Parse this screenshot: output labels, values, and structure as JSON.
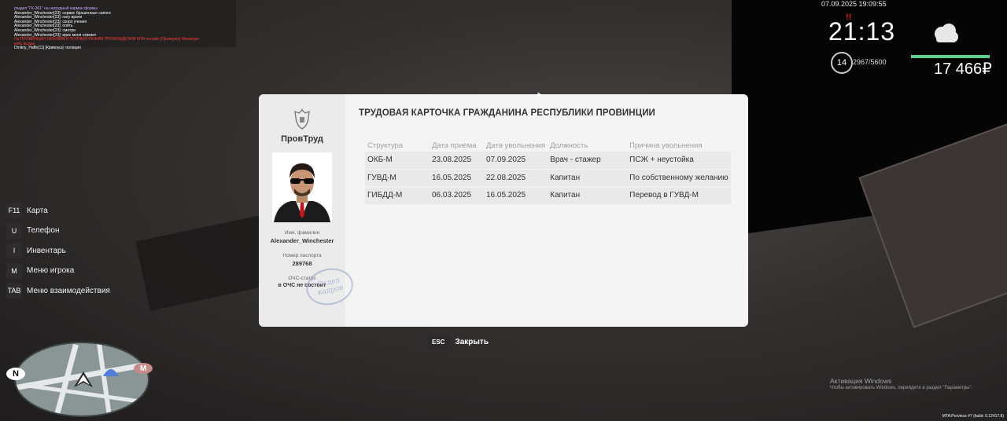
{
  "chat": [
    {
      "text": "раздел \"ГК-361\" на нагрудный карман формы",
      "color": "#c9a9ff"
    },
    {
      "text": "Alexander_Winchester[23]: сервис брошенные сапоги",
      "color": "#ffffff"
    },
    {
      "text": "Alexander_Winchester[23]: нагу врачи",
      "color": "#ffffff"
    },
    {
      "text": "Alexander_Winchester[23]: скоро учения",
      "color": "#ffffff"
    },
    {
      "text": "Alexander_Winchester[23]: опять",
      "color": "#ffffff"
    },
    {
      "text": "Alexander_Winchester[23]: смотри",
      "color": "#ffffff"
    },
    {
      "text": "Alexander_Winchester[23]: ирис меня отвезет",
      "color": "#ffffff"
    },
    {
      "text": "На ПРОВИНЦИИ ОБЪЯВЛЕН ПОЛНЫЙ РЕЖИМ ПРОХОЖДЕНИЯ МТА онлайн (Проверка) Минимум",
      "color": "#ff3b3b"
    },
    {
      "text": "кейс выдан",
      "color": "#ff3b3b"
    },
    {
      "text": "Dmitriy_Haffe[11] [Кривоуш]: полиция",
      "color": "#ffffff"
    }
  ],
  "hud": {
    "datetime": "07.09.2025 19:09:55",
    "mark": "!!",
    "clock": "21:13",
    "level": "14",
    "exp": "2967/5600",
    "bar_fill_percent": 100,
    "bar_color": "#5fd38e",
    "money": "17 466₽",
    "weather_icon": "cloud-icon"
  },
  "hotkeys": [
    {
      "key": "F11",
      "label": "Карта"
    },
    {
      "key": "U",
      "label": "Телефон"
    },
    {
      "key": "I",
      "label": "Инвентарь"
    },
    {
      "key": "M",
      "label": "Меню игрока"
    },
    {
      "key": "TAB",
      "label": "Меню взаимодействия"
    }
  ],
  "minimap": {
    "north": "N",
    "metro": "M"
  },
  "card": {
    "org": "ПровТруд",
    "title": "ТРУДОВАЯ КАРТОЧКА ГРАЖДАНИНА РЕСПУБЛИКИ ПРОВИНЦИИ",
    "name_label": "Имя, фамилия",
    "name": "Alexander_Winchester",
    "passport_label": "Номер паспорта",
    "passport": "289768",
    "status_label": "ОЧС-статус",
    "status": "в ОЧС не состоит",
    "stamp_line1": "Отдел",
    "stamp_line2": "кадров",
    "columns": [
      "Структура",
      "Дата приема",
      "Дата увольнения",
      "Должность",
      "Причина увольнения"
    ],
    "rows": [
      [
        "ОКБ-М",
        "23.08.2025",
        "07.09.2025",
        "Врач - стажер",
        "ПСЖ + неустойка"
      ],
      [
        "ГУВД-М",
        "16.05.2025",
        "22.08.2025",
        "Капитан",
        "По собственному желанию"
      ],
      [
        "ГИБДД-М",
        "06.03.2025",
        "16.05.2025",
        "Капитан",
        "Перевод в ГУВД-М"
      ]
    ]
  },
  "close": {
    "key": "ESC",
    "label": "Закрыть"
  },
  "windows_activation": {
    "line1": "Активация Windows",
    "line2": "Чтобы активировать Windows, перейдите в раздел \"Параметры\"."
  },
  "build": "MTA:Province #7 (build: 0.12417.8)"
}
